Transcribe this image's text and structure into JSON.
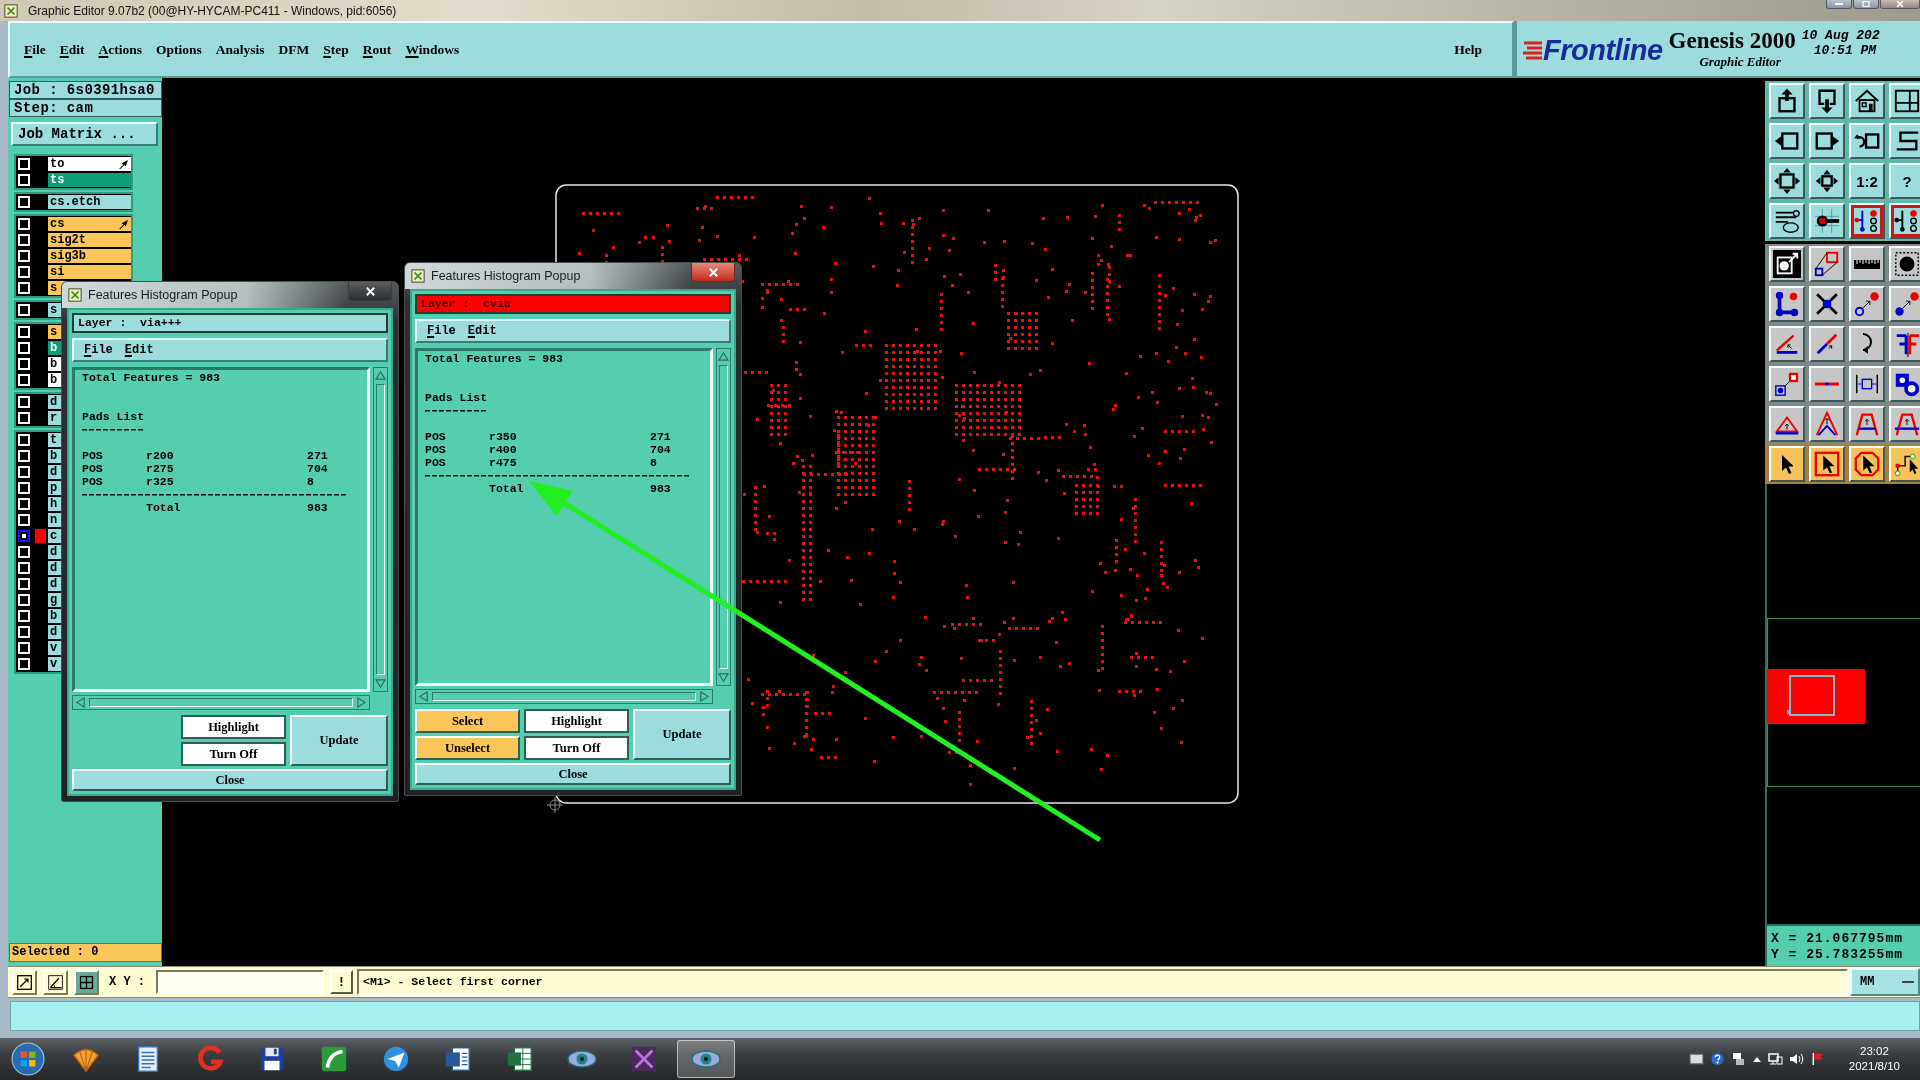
{
  "window": {
    "title": "Graphic Editor 9.07b2 (00@HY-HYCAM-PC411 - Windows, pid:6056)"
  },
  "menu": [
    {
      "label": "File",
      "mnemonic": true
    },
    {
      "label": "Edit",
      "mnemonic": true
    },
    {
      "label": "Actions",
      "mnemonic": true
    },
    {
      "label": "Options",
      "mnemonic": false
    },
    {
      "label": "Analysis",
      "mnemonic": false
    },
    {
      "label": "DFM",
      "mnemonic": false
    },
    {
      "label": "Step",
      "mnemonic": true
    },
    {
      "label": "Rout",
      "mnemonic": true
    },
    {
      "label": "Windows",
      "mnemonic": true
    }
  ],
  "help": {
    "label": "Help",
    "mnemonic": false
  },
  "brand": {
    "logo": "Frontline",
    "product": "Genesis 2000",
    "subtitle": "Graphic Editor",
    "date": "10 Aug 202",
    "time": "10:51 PM"
  },
  "job": {
    "job": "Job : 6s0391hsa0",
    "step": "Step: cam",
    "matrix_button": "Job Matrix ...",
    "selected": "Selected : 0"
  },
  "layers": [
    {
      "layers": [
        {
          "name": "to",
          "kind": "silk_screen",
          "displayed": false,
          "marked": true
        },
        {
          "name": "ts",
          "kind": "solder_mask",
          "displayed": false,
          "marked": false
        }
      ]
    },
    {
      "layers": [
        {
          "name": "cs.etch",
          "kind": "misc",
          "displayed": false,
          "marked": false
        }
      ]
    },
    {
      "layers": [
        {
          "name": "cs",
          "kind": "signal",
          "displayed": false,
          "marked": true
        },
        {
          "name": "sig2t",
          "kind": "signal",
          "displayed": false,
          "marked": false
        },
        {
          "name": "sig3b",
          "kind": "signal",
          "displayed": false,
          "marked": false
        },
        {
          "name": "si",
          "kind": "signal",
          "displayed": false,
          "marked": false
        },
        {
          "name": "s",
          "kind": "signal",
          "displayed": false,
          "marked": false
        }
      ]
    },
    {
      "layers": [
        {
          "name": "s",
          "kind": "misc",
          "displayed": false,
          "marked": false
        }
      ]
    },
    {
      "layers": [
        {
          "name": "s",
          "kind": "signal",
          "displayed": false,
          "marked": false
        },
        {
          "name": "b",
          "kind": "solder_mask",
          "displayed": false,
          "marked": false
        },
        {
          "name": "b",
          "kind": "silk_screen",
          "displayed": false,
          "marked": false
        },
        {
          "name": "b",
          "kind": "silk_screen",
          "displayed": false,
          "marked": false
        }
      ]
    },
    {
      "layers": [
        {
          "name": "d",
          "kind": "misc",
          "displayed": false,
          "marked": false
        },
        {
          "name": "r",
          "kind": "misc",
          "displayed": false,
          "marked": false
        }
      ]
    },
    {
      "layers": [
        {
          "name": "t",
          "kind": "misc",
          "displayed": false,
          "marked": false
        },
        {
          "name": "b",
          "kind": "misc",
          "displayed": false,
          "marked": false
        },
        {
          "name": "d",
          "kind": "misc",
          "displayed": false,
          "marked": false
        },
        {
          "name": "p",
          "kind": "misc",
          "displayed": false,
          "marked": false
        },
        {
          "name": "h",
          "kind": "misc",
          "displayed": false,
          "marked": false
        },
        {
          "name": "n",
          "kind": "misc",
          "displayed": false,
          "marked": false
        },
        {
          "name": "c",
          "kind": "misc",
          "displayed": true,
          "marked": false,
          "color": "#ff0000"
        },
        {
          "name": "d",
          "kind": "misc",
          "displayed": false,
          "marked": false
        },
        {
          "name": "d",
          "kind": "misc",
          "displayed": false,
          "marked": false
        },
        {
          "name": "d",
          "kind": "misc",
          "displayed": false,
          "marked": false
        },
        {
          "name": "g",
          "kind": "misc",
          "displayed": false,
          "marked": false
        },
        {
          "name": "b",
          "kind": "misc",
          "displayed": false,
          "marked": false
        },
        {
          "name": "d",
          "kind": "misc",
          "displayed": false,
          "marked": false
        },
        {
          "name": "v",
          "kind": "misc",
          "displayed": false,
          "marked": false
        },
        {
          "name": "v",
          "kind": "misc",
          "displayed": false,
          "marked": false
        }
      ]
    }
  ],
  "popups": [
    {
      "title": "Features Histogram Popup",
      "active": false,
      "layer": {
        "text": "Layer :  via+++"
      },
      "menu": [
        {
          "label": "File",
          "mnemonic": true
        },
        {
          "label": "Edit",
          "mnemonic": true
        }
      ],
      "report": {
        "total": "Total Features = 983",
        "section": "Pads List",
        "rows": [
          {
            "type": "POS",
            "symbol": "r200",
            "count": "271"
          },
          {
            "type": "POS",
            "symbol": "r275",
            "count": "704"
          },
          {
            "type": "POS",
            "symbol": "r325",
            "count": "8"
          }
        ],
        "total_label": "Total",
        "total_count": "983"
      },
      "buttons": [
        {
          "label": "Highlight",
          "kind": "toggle"
        },
        {
          "label": "Turn Off",
          "kind": "toggle"
        },
        {
          "label": "Update",
          "kind": "update"
        },
        {
          "label": "Close",
          "kind": "close"
        }
      ]
    },
    {
      "title": "Features Histogram Popup",
      "active": true,
      "layer": {
        "text": "Layer :  cvia",
        "color": "#ff0000"
      },
      "menu": [
        {
          "label": "File",
          "mnemonic": true
        },
        {
          "label": "Edit",
          "mnemonic": true
        }
      ],
      "report": {
        "total": "Total Features = 983",
        "section": "Pads List",
        "rows": [
          {
            "type": "POS",
            "symbol": "r350",
            "count": "271"
          },
          {
            "type": "POS",
            "symbol": "r400",
            "count": "704"
          },
          {
            "type": "POS",
            "symbol": "r475",
            "count": "8"
          }
        ],
        "total_label": "Total",
        "total_count": "983"
      },
      "buttons": [
        {
          "label": "Select",
          "kind": "select"
        },
        {
          "label": "Unselect",
          "kind": "select"
        },
        {
          "label": "Highlight",
          "kind": "toggle"
        },
        {
          "label": "Turn Off",
          "kind": "toggle"
        },
        {
          "label": "Update",
          "kind": "update"
        },
        {
          "label": "Close",
          "kind": "close"
        }
      ]
    }
  ],
  "tools": [
    {
      "on": false
    },
    {
      "on": false
    },
    {
      "on": false
    },
    {
      "on": false
    },
    {
      "on": false
    },
    {
      "on": false
    },
    {
      "on": false
    },
    {
      "on": false
    },
    {
      "on": false
    },
    {
      "on": false
    },
    {
      "label": "1:2",
      "on": false
    },
    {
      "label": "?",
      "on": false
    },
    {
      "on": false
    },
    {
      "on": false
    },
    {
      "on": true
    },
    {
      "on": true
    },
    {
      "on": false
    },
    {
      "on": false
    },
    {
      "on": false
    },
    {
      "on": false
    },
    {
      "on": false
    },
    {
      "on": false
    },
    {
      "on": false
    },
    {
      "on": false
    },
    {
      "on": false
    },
    {
      "on": false
    },
    {
      "on": false
    },
    {
      "on": false
    },
    {
      "on": false
    },
    {
      "on": false
    },
    {
      "on": false
    },
    {
      "on": false
    },
    {
      "on": false
    },
    {
      "on": false
    },
    {
      "on": false
    },
    {
      "on": false
    },
    {
      "on": false
    },
    {
      "on": false
    },
    {
      "on": false
    },
    {
      "on": false
    }
  ],
  "coordinates": {
    "x": "X = 21.067795mm",
    "y": "Y = 25.783255mm"
  },
  "command_bar": {
    "label": "X Y :",
    "bang": "!",
    "message": "<M1> - Select first corner",
    "units": "MM"
  },
  "taskbar": {
    "apps": [
      {
        "active": false
      },
      {
        "active": false
      },
      {
        "active": false
      },
      {
        "active": false
      },
      {
        "active": false
      },
      {
        "active": false
      },
      {
        "active": false
      },
      {
        "active": false
      },
      {
        "active": false
      },
      {
        "active": false
      },
      {
        "active": true
      }
    ],
    "time": "23:02",
    "date": "2021/8/10"
  }
}
